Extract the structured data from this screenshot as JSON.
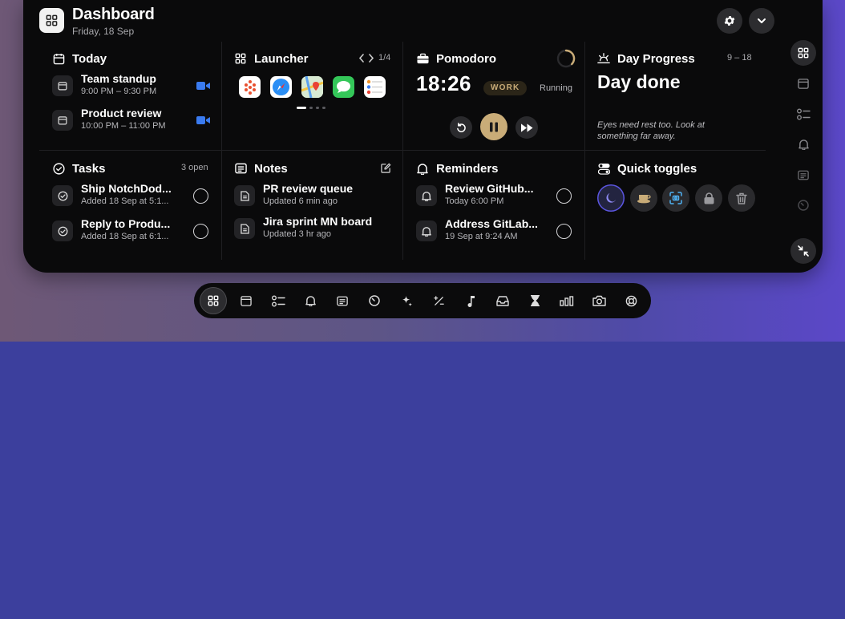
{
  "header": {
    "title": "Dashboard",
    "date": "Friday, 18 Sep",
    "settings_icon": "gear-icon",
    "collapse_icon": "chevron-down-icon"
  },
  "today": {
    "title": "Today",
    "events": [
      {
        "title": "Team standup",
        "time": "9:00 PM – 9:30 PM",
        "icon": "video-icon"
      },
      {
        "title": "Product review",
        "time": "10:00 PM – 11:00 PM",
        "icon": "video-icon"
      }
    ]
  },
  "launcher": {
    "title": "Launcher",
    "page": "1/4",
    "apps": [
      "scatter-app-icon",
      "safari-icon",
      "maps-icon",
      "messages-icon",
      "reminders-icon"
    ]
  },
  "pomodoro": {
    "title": "Pomodoro",
    "time": "18:26",
    "mode": "WORK",
    "status": "Running",
    "accent": "#c9ac78"
  },
  "day_progress": {
    "title": "Day Progress",
    "range": "9 – 18",
    "headline": "Day done",
    "tip": "Eyes need rest too. Look at something far away."
  },
  "tasks": {
    "title": "Tasks",
    "count": "3 open",
    "items": [
      {
        "title": "Ship NotchDod...",
        "sub": "Added 18 Sep at 5:1..."
      },
      {
        "title": "Reply to Produ...",
        "sub": "Added 18 Sep at 6:1..."
      }
    ]
  },
  "notes": {
    "title": "Notes",
    "items": [
      {
        "title": "PR review queue",
        "sub": "Updated 6 min ago"
      },
      {
        "title": "Jira sprint MN board",
        "sub": "Updated 3 hr ago"
      }
    ]
  },
  "reminders": {
    "title": "Reminders",
    "items": [
      {
        "title": "Review GitHub...",
        "sub": "Today 6:00 PM"
      },
      {
        "title": "Address GitLab...",
        "sub": "19 Sep at 9:24 AM"
      }
    ]
  },
  "quick_toggles": {
    "title": "Quick toggles",
    "items": [
      "moon-icon",
      "coffee-icon",
      "screenshot-icon",
      "lock-icon",
      "trash-icon"
    ],
    "active_color": "#5b55e0"
  },
  "sidebar": {
    "items": [
      "grid-icon",
      "calendar-icon",
      "checklist-icon",
      "bell-icon",
      "note-icon",
      "timer-icon"
    ],
    "collapse_icon": "collapse-arrows-icon"
  },
  "dock": {
    "items": [
      "grid-icon",
      "calendar-icon",
      "checklist-icon",
      "bell-icon",
      "note-icon",
      "timer-icon",
      "sparkle-icon",
      "calculator-icon",
      "music-icon",
      "inbox-icon",
      "hourglass-icon",
      "bars-icon",
      "camera-icon",
      "lifebuoy-icon"
    ]
  }
}
